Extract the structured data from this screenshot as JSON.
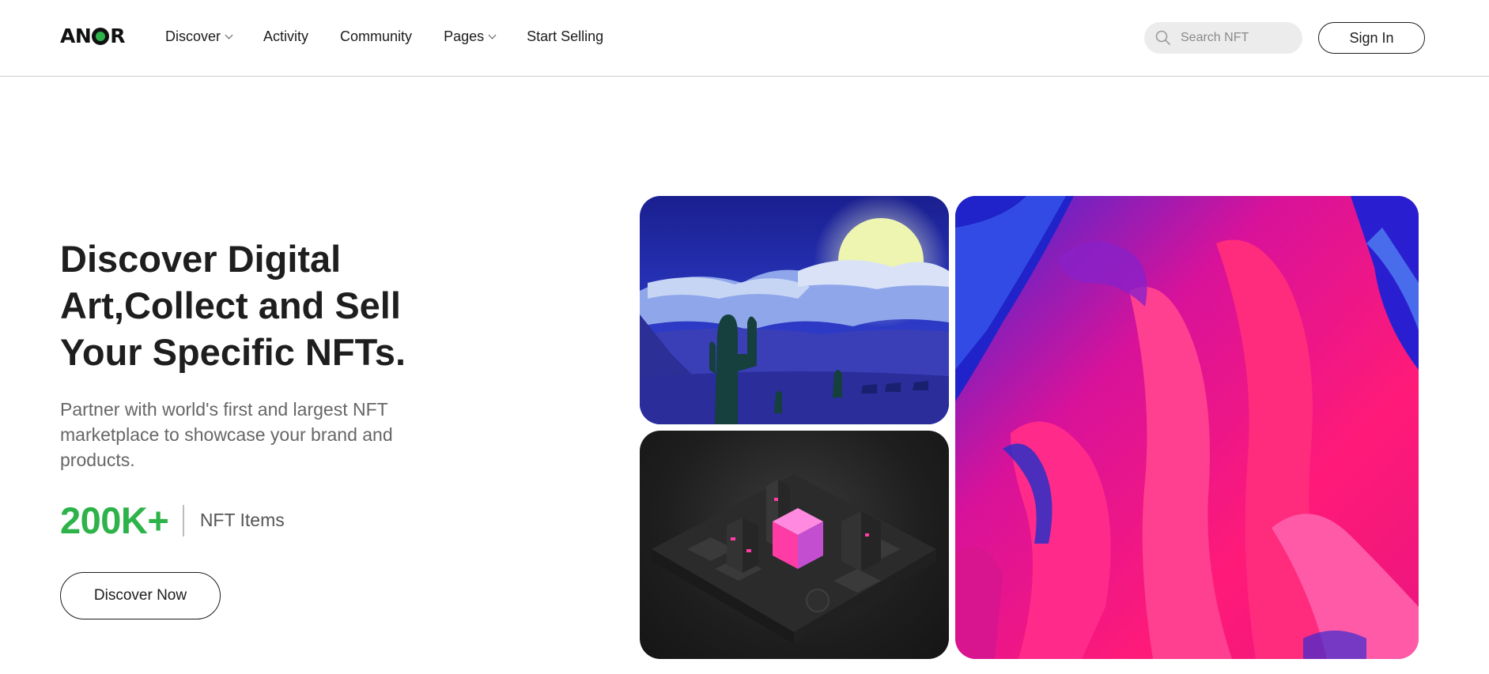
{
  "brand": {
    "logo_text_left": "AN",
    "logo_text_right": "R",
    "accent_color": "#2db34a"
  },
  "nav": {
    "items": [
      {
        "label": "Discover",
        "has_dropdown": true
      },
      {
        "label": "Activity",
        "has_dropdown": false
      },
      {
        "label": "Community",
        "has_dropdown": false
      },
      {
        "label": "Pages",
        "has_dropdown": true
      },
      {
        "label": "Start Selling",
        "has_dropdown": false
      }
    ]
  },
  "search": {
    "placeholder": "Search NFT",
    "value": "",
    "icon": "search-icon"
  },
  "header": {
    "signin_label": "Sign In"
  },
  "hero": {
    "title": "Discover Digital Art,Collect and Sell Your Specific NFTs.",
    "subtitle": "Partner with world's first and largest NFT marketplace to showcase your brand and products.",
    "stat_value": "200K+",
    "stat_label": "NFT Items",
    "cta_label": "Discover Now"
  },
  "gallery": {
    "images": [
      {
        "name": "moon-desert-artwork"
      },
      {
        "name": "isometric-city-artwork"
      },
      {
        "name": "abstract-paint-artwork"
      }
    ]
  }
}
